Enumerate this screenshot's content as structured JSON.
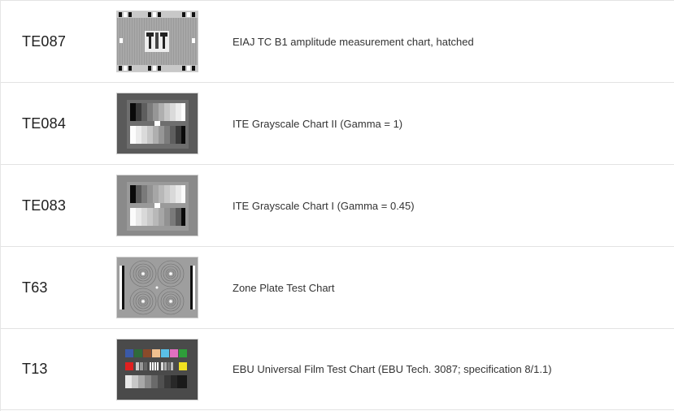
{
  "items": [
    {
      "code": "TE087",
      "description": "EIAJ TC B1 amplitude measurement chart, hatched",
      "thumbnail_icon": "eiaj-hatched-chart-thumbnail"
    },
    {
      "code": "TE084",
      "description": "ITE Grayscale Chart II (Gamma = 1)",
      "thumbnail_icon": "ite-grayscale-chart-2-thumbnail"
    },
    {
      "code": "TE083",
      "description": "ITE Grayscale Chart I (Gamma = 0.45)",
      "thumbnail_icon": "ite-grayscale-chart-1-thumbnail"
    },
    {
      "code": "T63",
      "description": "Zone Plate Test Chart",
      "thumbnail_icon": "zone-plate-chart-thumbnail"
    },
    {
      "code": "T13",
      "description": "EBU Universal Film Test Chart (EBU Tech. 3087; specification 8/1.1)",
      "thumbnail_icon": "ebu-film-test-chart-thumbnail"
    }
  ]
}
